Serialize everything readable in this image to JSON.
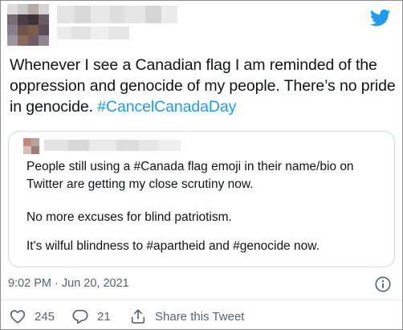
{
  "tweet": {
    "text_plain": "Whenever I see a Canadian flag I am reminded of the oppression and genocide of my people. There’s no pride in genocide. ",
    "hashtag": "#CancelCanadaDay",
    "timestamp": "9:02 PM · Jun 20, 2021"
  },
  "quoted_tweet": {
    "lines": [
      "People still using a #Canada flag emoji in their name/bio on",
      "Twitter are getting my close scrutiny now.",
      "No more excuses for blind patriotism.",
      "It's wilful blindness to #apartheid and #genocide now."
    ]
  },
  "actions": {
    "likes": "245",
    "replies": "21",
    "share_label": "Share this Tweet"
  },
  "icons": {
    "brand": "twitter-bird-icon",
    "info": "info-icon",
    "like": "heart-icon",
    "reply": "reply-bubble-icon",
    "share": "share-upload-icon"
  },
  "colors": {
    "brand_blue": "#1d9bf0",
    "text": "#0f1419",
    "muted": "#536471",
    "border": "#cfd9de"
  }
}
